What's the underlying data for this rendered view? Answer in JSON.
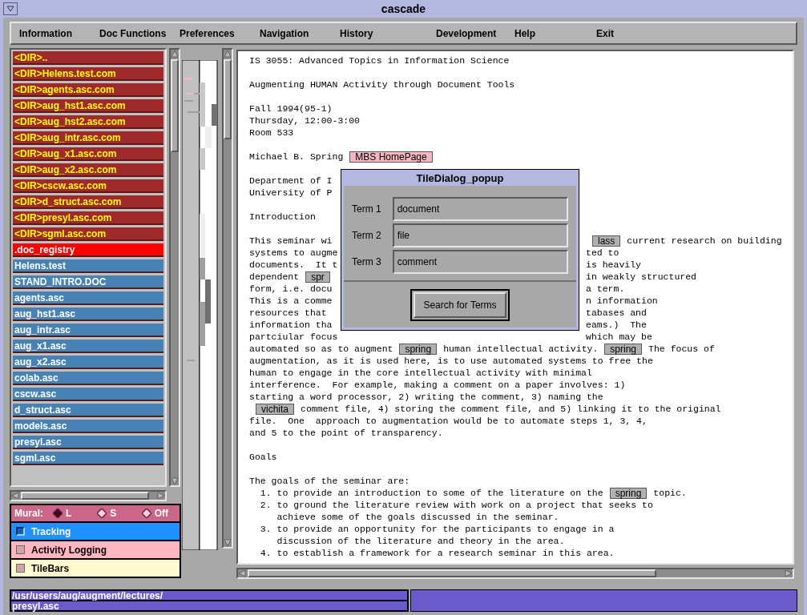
{
  "window": {
    "title": "cascade"
  },
  "menu": [
    "Information",
    "Doc Functions",
    "Preferences",
    "Navigation",
    "History",
    "Development",
    "Help",
    "Exit"
  ],
  "files": [
    {
      "name": "<DIR>..",
      "kind": "dir",
      "selected": false
    },
    {
      "name": "<DIR>Helens.test.com",
      "kind": "dir",
      "selected": false
    },
    {
      "name": "<DIR>agents.asc.com",
      "kind": "dir",
      "selected": false
    },
    {
      "name": "<DIR>aug_hst1.asc.com",
      "kind": "dir",
      "selected": false
    },
    {
      "name": "<DIR>aug_hst2.asc.com",
      "kind": "dir",
      "selected": false
    },
    {
      "name": "<DIR>aug_intr.asc.com",
      "kind": "dir",
      "selected": false
    },
    {
      "name": "<DIR>aug_x1.asc.com",
      "kind": "dir",
      "selected": false
    },
    {
      "name": "<DIR>aug_x2.asc.com",
      "kind": "dir",
      "selected": false
    },
    {
      "name": "<DIR>cscw.asc.com",
      "kind": "dir",
      "selected": false
    },
    {
      "name": "<DIR>d_struct.asc.com",
      "kind": "dir",
      "selected": false
    },
    {
      "name": "<DIR>presyl.asc.com",
      "kind": "dir",
      "selected": false
    },
    {
      "name": "<DIR>sgml.asc.com",
      "kind": "dir",
      "selected": false
    },
    {
      "name": ".doc_registry",
      "kind": "registry",
      "selected": false
    },
    {
      "name": "Helens.test",
      "kind": "file",
      "selected": false
    },
    {
      "name": "STAND_INTRO.DOC",
      "kind": "file",
      "selected": false
    },
    {
      "name": "agents.asc",
      "kind": "file",
      "selected": false
    },
    {
      "name": "aug_hst1.asc",
      "kind": "file",
      "selected": false
    },
    {
      "name": "aug_intr.asc",
      "kind": "file",
      "selected": false
    },
    {
      "name": "aug_x1.asc",
      "kind": "file",
      "selected": false
    },
    {
      "name": "aug_x2.asc",
      "kind": "file",
      "selected": false
    },
    {
      "name": "colab.asc",
      "kind": "file",
      "selected": false
    },
    {
      "name": "cscw.asc",
      "kind": "file",
      "selected": false
    },
    {
      "name": "d_struct.asc",
      "kind": "file",
      "selected": false
    },
    {
      "name": "models.asc",
      "kind": "file",
      "selected": false
    },
    {
      "name": "presyl.asc",
      "kind": "file",
      "selected": false
    },
    {
      "name": "sgml.asc",
      "kind": "file",
      "selected": false
    }
  ],
  "mural": {
    "label": "Mural:",
    "options": [
      {
        "label": "L",
        "selected": true
      },
      {
        "label": "S",
        "selected": false
      },
      {
        "label": "Off",
        "selected": false
      }
    ]
  },
  "toggles": [
    {
      "label": "Tracking",
      "checked": true,
      "color": "#1e90ff"
    },
    {
      "label": "Activity Logging",
      "checked": false,
      "color": "#ffb6c1"
    },
    {
      "label": "TileBars",
      "checked": false,
      "color": "#fffacd"
    }
  ],
  "path": [
    "/usr/users/aug/augment/lectures/",
    "presyl.asc"
  ],
  "document": {
    "blocks": [
      [
        {
          "segments": [
            {
              "kind": "text",
              "text": "IS 3055: Advanced Topics in Information Science"
            }
          ]
        }
      ],
      [
        {
          "segments": [
            {
              "kind": "text",
              "text": "Augmenting HUMAN Activity through Document Tools"
            }
          ]
        }
      ],
      [
        {
          "segments": [
            {
              "kind": "text",
              "text": "Fall 1994(95-1)"
            }
          ]
        },
        {
          "segments": [
            {
              "kind": "text",
              "text": "Thursday, 12:00-3:00"
            }
          ]
        },
        {
          "segments": [
            {
              "kind": "text",
              "text": "Room 533"
            }
          ]
        }
      ],
      [
        {
          "segments": [
            {
              "kind": "text",
              "text": "Michael B. Spring"
            },
            {
              "kind": "link",
              "text": "MBS HomePage",
              "color": "#f4b6c2"
            }
          ]
        }
      ],
      [
        {
          "segments": [
            {
              "kind": "text",
              "text": "Department of I"
            }
          ]
        },
        {
          "segments": [
            {
              "kind": "text",
              "text": "University of P"
            }
          ]
        }
      ],
      [
        {
          "segments": [
            {
              "kind": "text",
              "text": "Introduction"
            }
          ]
        }
      ],
      [
        {
          "segments": [
            {
              "kind": "text",
              "text": "This seminar wi"
            }
          ],
          "right": [
            {
              "kind": "link",
              "text": "lass",
              "color": "#b0b0b0"
            },
            {
              "kind": "text",
              "text": "current research on building"
            }
          ]
        },
        {
          "segments": [
            {
              "kind": "text",
              "text": "systems to augme"
            }
          ],
          "right": [
            {
              "kind": "text",
              "text": "ted to"
            }
          ]
        },
        {
          "segments": [
            {
              "kind": "text",
              "text": "documents.  It t"
            }
          ],
          "right": [
            {
              "kind": "text",
              "text": "is heavily"
            }
          ]
        },
        {
          "segments": [
            {
              "kind": "text",
              "text": "dependent"
            },
            {
              "kind": "link",
              "text": "spr",
              "color": "#b0b0b0"
            }
          ],
          "right": [
            {
              "kind": "text",
              "text": "in weakly structured"
            }
          ]
        },
        {
          "segments": [
            {
              "kind": "text",
              "text": "form, i.e. docu"
            }
          ],
          "right": [
            {
              "kind": "text",
              "text": "a term."
            }
          ]
        },
        {
          "segments": [
            {
              "kind": "text",
              "text": "This is a comme"
            }
          ],
          "right": [
            {
              "kind": "text",
              "text": "n information"
            }
          ]
        },
        {
          "segments": [
            {
              "kind": "text",
              "text": "resources that"
            }
          ],
          "right": [
            {
              "kind": "text",
              "text": "tabases and"
            }
          ]
        },
        {
          "segments": [
            {
              "kind": "text",
              "text": "information tha"
            }
          ],
          "right": [
            {
              "kind": "text",
              "text": "eams.)  The"
            }
          ]
        },
        {
          "segments": [
            {
              "kind": "text",
              "text": "partciular focus"
            }
          ],
          "right": [
            {
              "kind": "text",
              "text": "which may be"
            }
          ]
        },
        {
          "segments": [
            {
              "kind": "text",
              "text": "automated so as to augment"
            },
            {
              "kind": "link",
              "text": "spring",
              "color": "#b0b0b0"
            },
            {
              "kind": "text",
              "text": "human intellectual activity."
            },
            {
              "kind": "link",
              "text": "spring",
              "color": "#b0b0b0"
            },
            {
              "kind": "text",
              "text": "The focus of"
            }
          ]
        },
        {
          "segments": [
            {
              "kind": "text",
              "text": "augmentation, as it is used here, is to use automated systems to free the"
            }
          ]
        },
        {
          "segments": [
            {
              "kind": "text",
              "text": "human to engage in the core intellectual activity with minimal"
            }
          ]
        },
        {
          "segments": [
            {
              "kind": "text",
              "text": "interference.  For example, making a comment on a paper involves: 1)"
            }
          ]
        },
        {
          "segments": [
            {
              "kind": "text",
              "text": "starting a word processor, 2) writing the comment, 3) naming the"
            }
          ]
        },
        {
          "segments": [
            {
              "kind": "link",
              "text": "vichita",
              "color": "#b0b0b0"
            },
            {
              "kind": "text",
              "text": "comment file, 4) storing the comment file, and 5) linking it to the original"
            }
          ]
        },
        {
          "segments": [
            {
              "kind": "text",
              "text": "file.  One  approach to augmentation would be to automate steps 1, 3, 4,"
            }
          ]
        },
        {
          "segments": [
            {
              "kind": "text",
              "text": "and 5 to the point of transparency."
            }
          ]
        }
      ],
      [
        {
          "segments": [
            {
              "kind": "text",
              "text": "Goals"
            }
          ]
        }
      ],
      [
        {
          "segments": [
            {
              "kind": "text",
              "text": "The goals of the seminar are:"
            }
          ]
        },
        {
          "segments": [
            {
              "kind": "text",
              "text": "  1. to provide an introduction to some of the literature on the"
            },
            {
              "kind": "link",
              "text": "spring",
              "color": "#b0b0b0"
            },
            {
              "kind": "text",
              "text": "topic."
            }
          ]
        },
        {
          "segments": [
            {
              "kind": "text",
              "text": "  2. to ground the literature review with work on a project that seeks to"
            }
          ]
        },
        {
          "segments": [
            {
              "kind": "text",
              "text": "     achieve some of the goals discussed in the seminar."
            }
          ]
        },
        {
          "segments": [
            {
              "kind": "text",
              "text": "  3. to provide an opportunity for the participants to engage in a"
            }
          ]
        },
        {
          "segments": [
            {
              "kind": "text",
              "text": "     discussion of the literature and theory in the area."
            }
          ]
        },
        {
          "segments": [
            {
              "kind": "text",
              "text": "  4. to establish a framework for a research seminar in this area."
            }
          ]
        }
      ]
    ]
  },
  "dialog": {
    "title": "TileDialog_popup",
    "fields": [
      {
        "label": "Term 1",
        "value": "document"
      },
      {
        "label": "Term 2",
        "value": "file"
      },
      {
        "label": "Term 3",
        "value": "comment"
      }
    ],
    "button": "Search for Terms"
  }
}
